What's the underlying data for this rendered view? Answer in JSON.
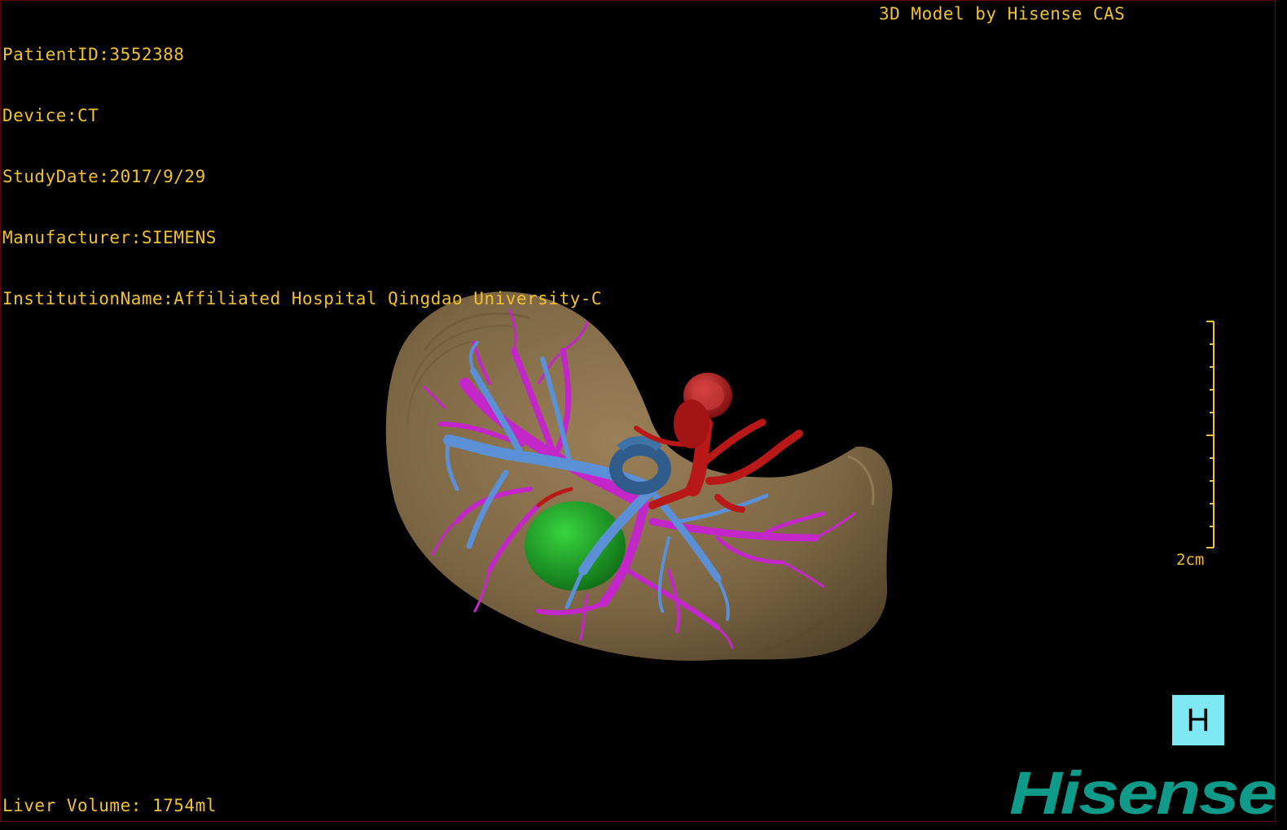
{
  "study": {
    "patient_id": "PatientID:3552388",
    "device": "Device:CT",
    "study_date": "StudyDate:2017/9/29",
    "manufacturer": "Manufacturer:SIEMENS",
    "institution": "InstitutionName:Affiliated Hospital Qingdao University-C"
  },
  "model_credit": "3D Model by Hisense CAS",
  "liver_volume": "Liver Volume: 1754ml",
  "scale_bar": {
    "label": "2cm"
  },
  "orientation_button": {
    "label": "H"
  },
  "brand": {
    "name": "Hisense"
  },
  "colors": {
    "overlay_text": "#f2c12e",
    "liver": "#8a7150",
    "hepatic_vein": "#c427c9",
    "portal_vein": "#5b8fd6",
    "artery": "#b81818",
    "tumor": "#1fb12a",
    "orientation_button": "#7fe9f3",
    "brand": "#0f9a8a"
  }
}
